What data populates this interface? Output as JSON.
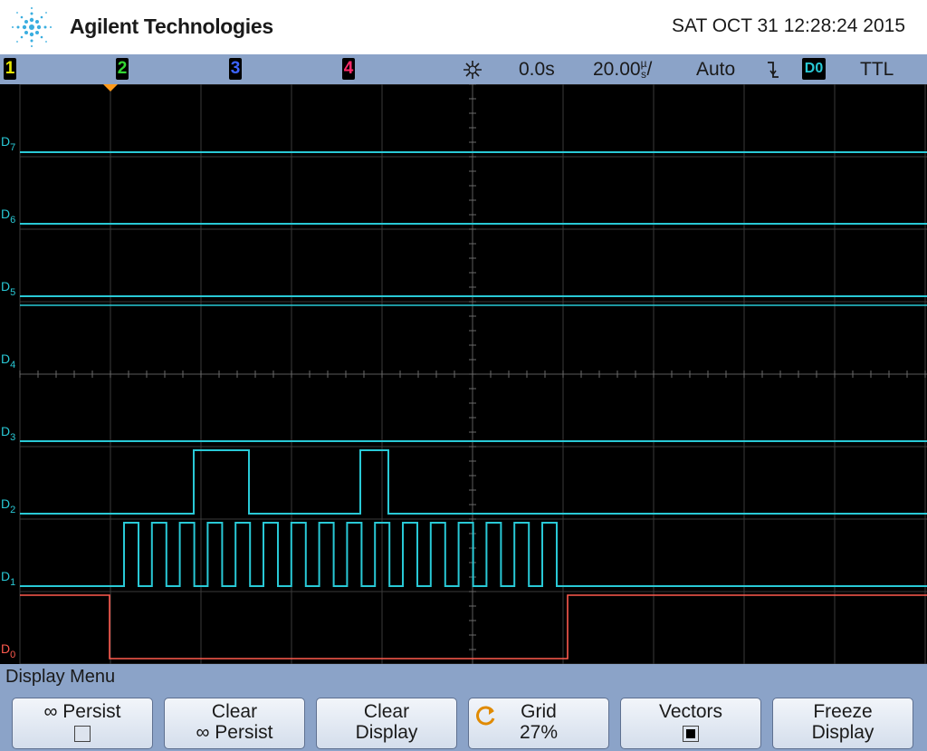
{
  "header": {
    "brand": "Agilent Technologies",
    "datetime": "SAT OCT 31 12:28:24 2015"
  },
  "statusbar": {
    "ch1": "1",
    "ch2": "2",
    "ch3": "3",
    "ch4": "4",
    "trigger_icon": "acquire-icon",
    "delay": "0.0s",
    "timebase": "20.00",
    "timebase_unit": "/",
    "mode": "Auto",
    "slope_icon": "falling-edge-icon",
    "trigger_source": "D0",
    "threshold": "TTL"
  },
  "colors": {
    "ch1": "#e8e800",
    "ch2": "#33d633",
    "ch3": "#3c64ff",
    "ch4": "#ff2a6a",
    "digital": "#29c9d6",
    "d0": "#ff5a4e",
    "bar": "#8ba3c8",
    "trigger_marker": "#ff9a1a"
  },
  "channels": {
    "d7": "D7",
    "d6": "D6",
    "d5": "D5",
    "d4": "D4",
    "d3": "D3",
    "d2": "D2",
    "d1": "D1",
    "d0": "D0"
  },
  "menu": {
    "title": "Display Menu",
    "softkeys": [
      {
        "line1": "∞ Persist",
        "line2": ""
      },
      {
        "line1": "Clear",
        "line2": "∞ Persist"
      },
      {
        "line1": "Clear",
        "line2": "Display"
      },
      {
        "line1": "Grid",
        "line2": "27%"
      },
      {
        "line1": "Vectors",
        "line2": ""
      },
      {
        "line1": "Freeze",
        "line2": "Display"
      }
    ]
  }
}
